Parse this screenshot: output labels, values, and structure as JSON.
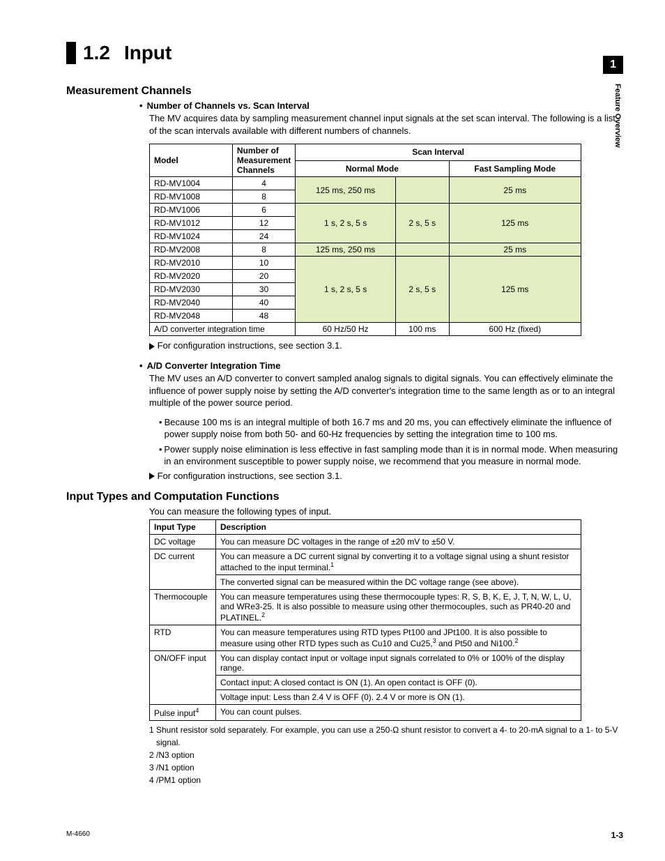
{
  "chapter_tab": "1",
  "side_label": "Feature Overview",
  "title_num": "1.2",
  "title_text": "Input",
  "section1": {
    "heading": "Measurement Channels",
    "sub1": {
      "title": "Number of Channels vs. Scan Interval",
      "body": "The MV acquires data by sampling measurement channel input signals at the set scan interval. The following is a list of the scan intervals available with different numbers of channels.",
      "caption": "For configuration instructions, see section 3.1."
    },
    "sub2": {
      "title": "A/D Converter Integration Time",
      "body": "The MV uses an A/D converter to convert sampled analog signals to digital signals. You can effectively eliminate the influence of power supply noise by setting the A/D converter's integration time to the same length as or to an integral multiple of the power source period.",
      "b1": "Because 100 ms is an integral multiple of both 16.7 ms and 20 ms, you can effectively eliminate the influence of power supply noise from both 50- and 60-Hz frequencies by setting the integration time to 100 ms.",
      "b2": "Power supply noise elimination is less effective in fast sampling mode than it is in normal mode. When measuring in an environment susceptible to power supply noise, we recommend that you measure in normal mode.",
      "caption": "For configuration instructions, see section 3.1."
    }
  },
  "table1": {
    "h_model": "Model",
    "h_channels": "Number of Measurement Channels",
    "h_scan": "Scan Interval",
    "h_normal": "Normal Mode",
    "h_fast": "Fast Sampling Mode",
    "g1": {
      "r1_model": "RD-MV1004",
      "r1_ch": "4",
      "r2_model": "RD-MV1008",
      "r2_ch": "8",
      "normal": "125 ms, 250 ms",
      "fast": "25 ms"
    },
    "g2": {
      "r1_model": "RD-MV1006",
      "r1_ch": "6",
      "r2_model": "RD-MV1012",
      "r2_ch": "12",
      "r3_model": "RD-MV1024",
      "r3_ch": "24",
      "normal1": "1 s, 2 s, 5 s",
      "normal2": "2 s, 5 s",
      "fast": "125 ms"
    },
    "g3": {
      "r1_model": "RD-MV2008",
      "r1_ch": "8",
      "normal": "125 ms, 250 ms",
      "fast": "25 ms"
    },
    "g4": {
      "r1_model": "RD-MV2010",
      "r1_ch": "10",
      "r2_model": "RD-MV2020",
      "r2_ch": "20",
      "r3_model": "RD-MV2030",
      "r3_ch": "30",
      "r4_model": "RD-MV2040",
      "r4_ch": "40",
      "r5_model": "RD-MV2048",
      "r5_ch": "48",
      "normal1": "1 s, 2 s, 5 s",
      "normal2": "2 s, 5 s",
      "fast": "125 ms"
    },
    "footer": {
      "label": "A/D converter integration time",
      "v1": "60 Hz/50 Hz",
      "v2": "100 ms",
      "v3": "600 Hz (fixed)"
    }
  },
  "section2": {
    "heading": "Input Types and Computation Functions",
    "intro": "You can measure the following types of input."
  },
  "table2": {
    "hdr1": "Input Type",
    "hdr2": "Description",
    "r1_t": "DC voltage",
    "r1_d": "You can measure DC voltages in the range of ±20 mV to ±50 V.",
    "r2_t": "DC current",
    "r2_d1a": "You can measure a DC current signal by converting it to a voltage signal using a shunt resistor attached to the input terminal.",
    "r2_d1sup": "1",
    "r2_d2": "The converted signal can be measured within the DC voltage range (see above).",
    "r3_t": "Thermocouple",
    "r3_d_a": "You can measure temperatures using these thermocouple types: R, S, B, K, E, J, T, N, W, L, U, and WRe3-25. It is also possible to measure using other thermocouples, such as PR40-20 and PLATINEL.",
    "r3_sup": "2",
    "r4_t": "RTD",
    "r4_d_a": "You can measure temperatures using RTD types Pt100 and JPt100. It is also possible to measure using other RTD types such as Cu10 and Cu25,",
    "r4_sup1": "3",
    "r4_d_b": " and Pt50 and Ni100.",
    "r4_sup2": "2",
    "r5_t": "ON/OFF input",
    "r5_d1": "You can display contact input or voltage input signals correlated to 0% or 100% of the display range.",
    "r5_d2": "Contact input: A closed contact is ON (1). An open contact is OFF (0).",
    "r5_d3": "Voltage input: Less than 2.4 V is OFF (0). 2.4 V or more is ON (1).",
    "r6_t_a": "Pulse input",
    "r6_sup": "4",
    "r6_d": "You can count pulses."
  },
  "notes": {
    "n1": "1 Shunt resistor sold separately. For example, you can use a 250-Ω shunt resistor to convert a 4- to 20-mA signal to a 1- to 5-V signal.",
    "n2": "2 /N3 option",
    "n3": "3 /N1 option",
    "n4": "4 /PM1 option"
  },
  "footer": {
    "left": "M-4660",
    "right": "1-3"
  }
}
